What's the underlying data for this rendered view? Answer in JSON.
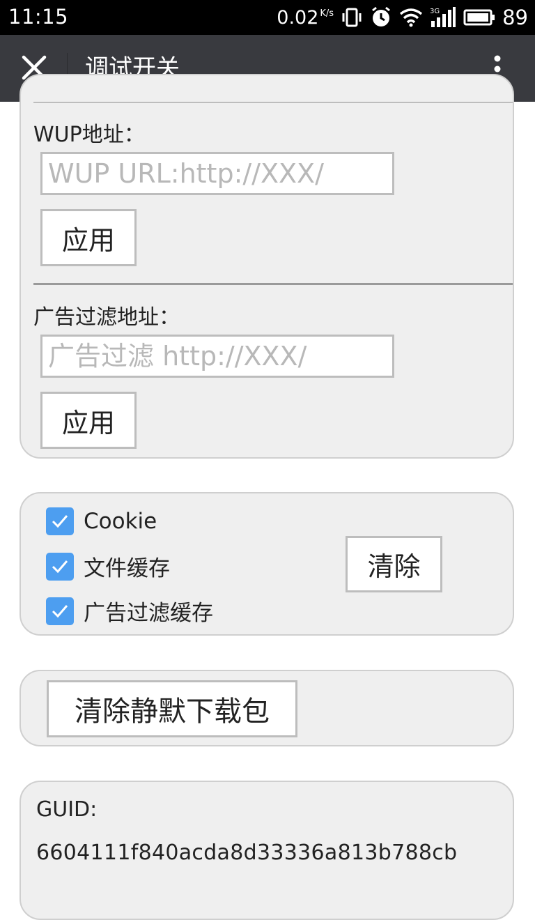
{
  "status_bar": {
    "time": "11:15",
    "net_speed": "0.02",
    "net_speed_unit": "K/s",
    "network": "3G",
    "battery": "89"
  },
  "title_bar": {
    "title": "调试开关"
  },
  "settings": {
    "wup": {
      "label": "WUP地址：",
      "placeholder": "WUP URL:http://XXX/",
      "apply": "应用"
    },
    "ad_filter": {
      "label": "广告过滤地址：",
      "placeholder": "广告过滤 http://XXX/",
      "apply": "应用"
    }
  },
  "cache": {
    "options": [
      {
        "label": "Cookie",
        "checked": true
      },
      {
        "label": "文件缓存",
        "checked": true
      },
      {
        "label": "广告过滤缓存",
        "checked": true
      }
    ],
    "clear": "清除"
  },
  "silent_download": {
    "clear": "清除静默下载包"
  },
  "guid": {
    "label": "GUID:",
    "value": "6604111f840acda8d33336a813b788cb"
  },
  "colors": {
    "titlebar": "#393a3f",
    "checkbox": "#4d9ef0",
    "panel": "#efefef"
  }
}
